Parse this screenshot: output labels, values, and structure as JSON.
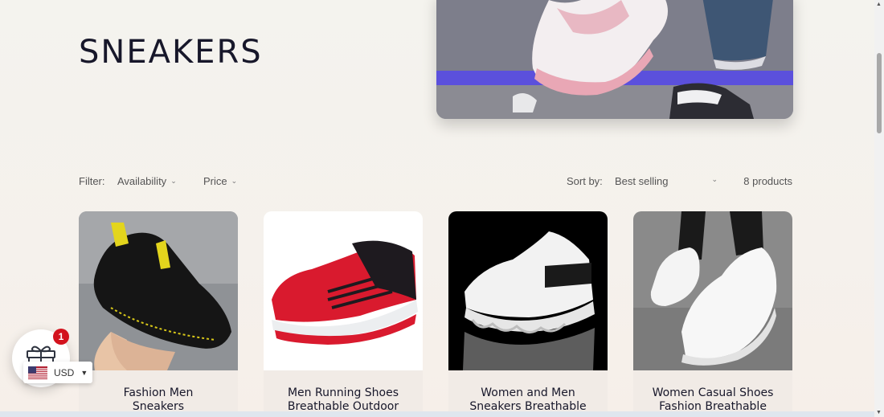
{
  "collection": {
    "title": "SNEAKERS"
  },
  "filters": {
    "filter_label": "Filter:",
    "availability": "Availability",
    "price": "Price",
    "sort_label": "Sort by:",
    "sort_value": "Best selling",
    "product_count": "8 products"
  },
  "products": [
    {
      "title": "Fashion Men Sneakers",
      "line1": "Fashion Men",
      "line2": "Sneakers"
    },
    {
      "title": "Men Running Shoes Breathable Outdoor",
      "line1": "Men Running Shoes",
      "line2": "Breathable Outdoor"
    },
    {
      "title": "Women and Men Sneakers Breathable",
      "line1": "Women and Men",
      "line2": "Sneakers Breathable"
    },
    {
      "title": "Women Casual Shoes Fashion Breathable",
      "line1": "Women Casual Shoes",
      "line2": "Fashion Breathable"
    }
  ],
  "gift_widget": {
    "badge": "1",
    "icon": "gift-icon"
  },
  "currency": {
    "code": "USD",
    "flag": "us-flag-icon"
  },
  "colors": {
    "accent_badge": "#d3121d",
    "title": "#17172a"
  }
}
